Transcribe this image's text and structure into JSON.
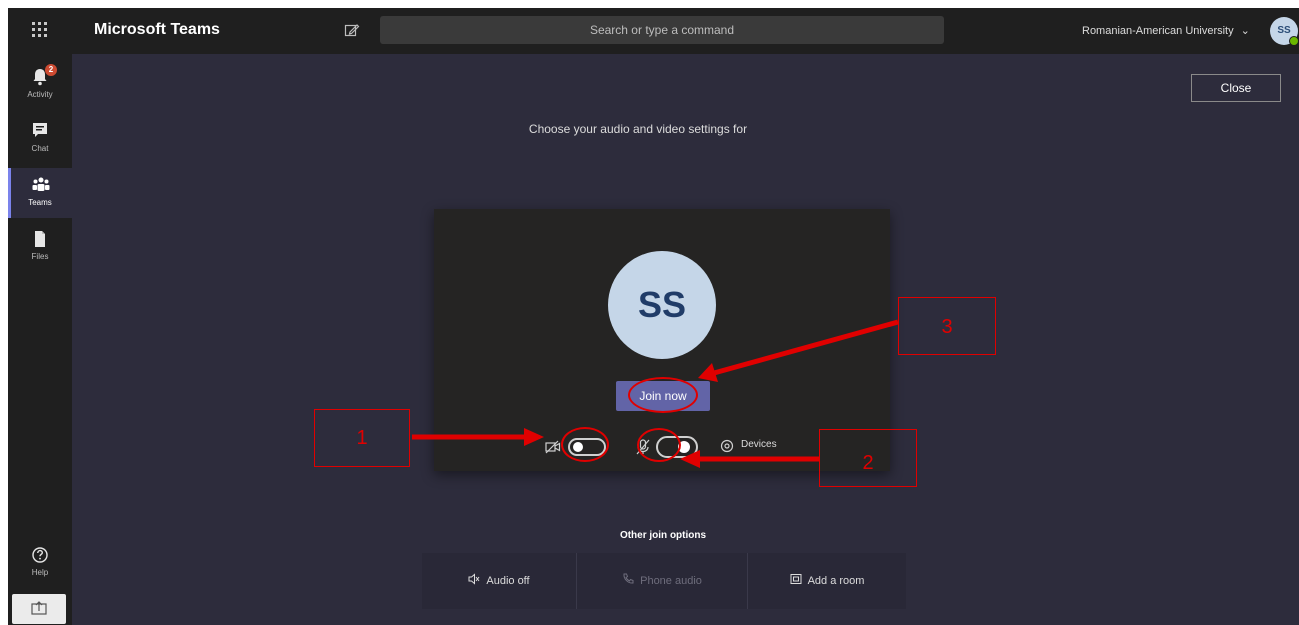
{
  "app": {
    "title": "Microsoft Teams"
  },
  "search": {
    "placeholder": "Search or type a command"
  },
  "header": {
    "org": "Romanian-American University",
    "avatar_initials": "SS"
  },
  "rail": {
    "activity_label": "Activity",
    "activity_badge": "2",
    "chat_label": "Chat",
    "teams_label": "Teams",
    "files_label": "Files",
    "help_label": "Help"
  },
  "meeting": {
    "close_label": "Close",
    "prompt": "Choose your audio and video settings for",
    "avatar_initials": "SS",
    "join_label": "Join now",
    "devices_label": "Devices",
    "other_options_title": "Other join options",
    "options": [
      {
        "label": "Audio off",
        "icon": "speaker-off-icon",
        "enabled": true
      },
      {
        "label": "Phone audio",
        "icon": "phone-icon",
        "enabled": false
      },
      {
        "label": "Add a room",
        "icon": "room-icon",
        "enabled": true
      }
    ],
    "camera_on": false,
    "mic_on": true
  },
  "annotations": [
    {
      "number": "1"
    },
    {
      "number": "2"
    },
    {
      "number": "3"
    }
  ],
  "colors": {
    "accent": "#6264a7",
    "annotation": "#e00000",
    "background": "#2d2c3c",
    "rail": "#1f1f1f"
  }
}
